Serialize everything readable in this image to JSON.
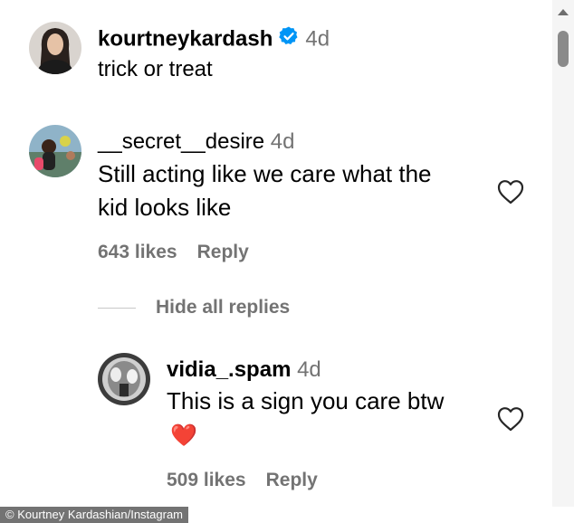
{
  "post": {
    "username": "kourtneykardash",
    "verified_icon": "verified-badge-icon",
    "time": "4d",
    "caption": "trick or treat"
  },
  "comment": {
    "username": "__secret__desire",
    "time": "4d",
    "text_line1": "Still acting like we care what the",
    "text_line2": "kid looks like",
    "likes": "643 likes",
    "reply": "Reply",
    "like_icon": "heart-outline-icon"
  },
  "replies_toggle": "Hide all replies",
  "reply_comment": {
    "username": "vidia_.spam",
    "time": "4d",
    "text_line1": "This is a sign you care btw",
    "emoji": "❤️",
    "likes": "509 likes",
    "reply": "Reply",
    "like_icon": "heart-outline-icon"
  },
  "photo_credit": "© Kourtney Kardashian/Instagram",
  "colors": {
    "verified_blue": "#0095f6",
    "secondary_text": "#737373",
    "emoji_heart": "#f0346b"
  }
}
